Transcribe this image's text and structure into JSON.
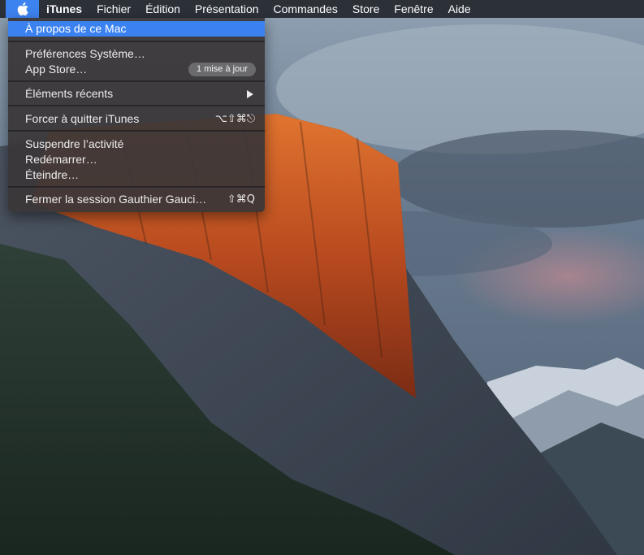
{
  "menubar": {
    "apple_icon": "apple-logo-icon",
    "app_name": "iTunes",
    "items": [
      "Fichier",
      "Édition",
      "Présentation",
      "Commandes",
      "Store",
      "Fenêtre",
      "Aide"
    ],
    "bar_color": "#1c1e24",
    "selected_color": "#3b82f0"
  },
  "apple_menu": {
    "about": "À propos de ce Mac",
    "system_prefs": "Préférences Système…",
    "app_store": "App Store…",
    "app_store_badge": "1 mise à jour",
    "recent_items": "Éléments récents",
    "force_quit": "Forcer à quitter iTunes",
    "force_quit_shortcut": "⌥⇧⌘⎋",
    "sleep": "Suspendre l’activité",
    "restart": "Redémarrer…",
    "shutdown": "Éteindre…",
    "logout": "Fermer la session Gauthier Gauci…",
    "logout_shortcut": "⇧⌘Q"
  }
}
